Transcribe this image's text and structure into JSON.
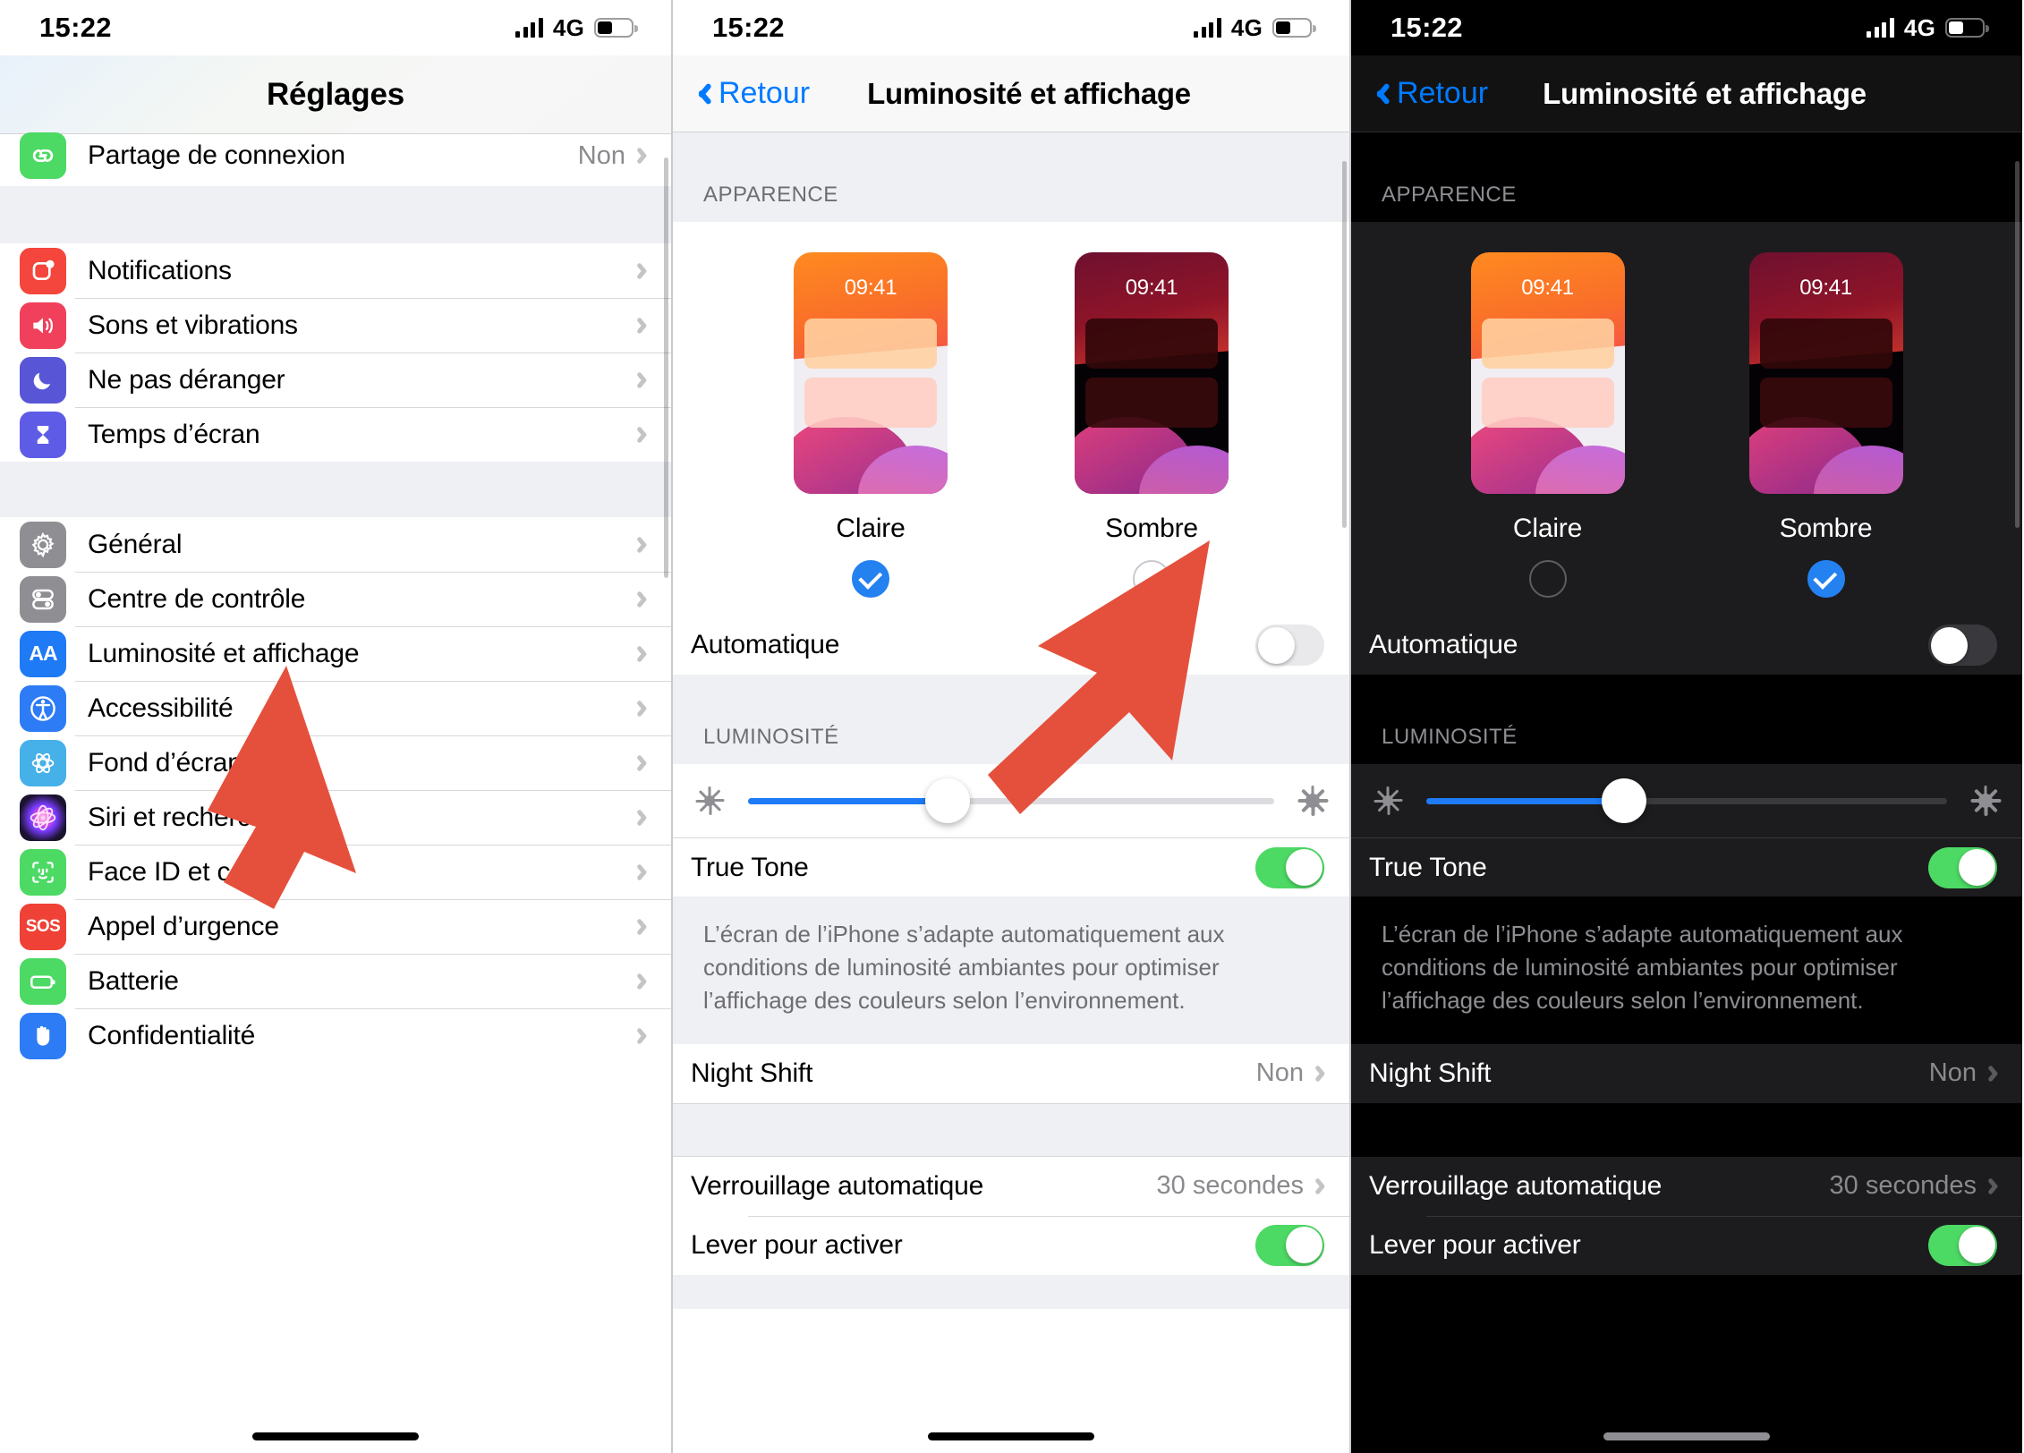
{
  "status": {
    "time": "15:22",
    "network": "4G",
    "battery_level_pct": 44
  },
  "panel1": {
    "title": "Réglages",
    "partial_row": {
      "label": "Partage de connexion",
      "value": "Non"
    },
    "group_a": [
      {
        "label": "Notifications",
        "icon": "notifications-icon",
        "color": "#f4463c"
      },
      {
        "label": "Sons et vibrations",
        "icon": "sound-icon",
        "color": "#f0405c"
      },
      {
        "label": "Ne pas déranger",
        "icon": "moon-icon",
        "color": "#5856d6"
      },
      {
        "label": "Temps d’écran",
        "icon": "hourglass-icon",
        "color": "#5e5ce6"
      }
    ],
    "group_b": [
      {
        "label": "Général",
        "icon": "gear-icon",
        "color": "#8e8e93"
      },
      {
        "label": "Centre de contrôle",
        "icon": "control-center-icon",
        "color": "#8e8e93"
      },
      {
        "label": "Luminosité et affichage",
        "icon": "brightness-aa-icon",
        "color": "#1f7af5"
      },
      {
        "label": "Accessibilité",
        "icon": "accessibility-icon",
        "color": "#2d7cf6"
      },
      {
        "label": "Fond d’écran",
        "icon": "wallpaper-icon",
        "color": "#46b0e8"
      },
      {
        "label": "Siri et recherche",
        "icon": "siri-icon",
        "color": "#1b1330"
      },
      {
        "label": "Face ID et code",
        "icon": "face-id-icon",
        "color": "#4cd964"
      },
      {
        "label": "Appel d’urgence",
        "icon": "sos-icon",
        "color": "#ef4136"
      },
      {
        "label": "Batterie",
        "icon": "battery-icon",
        "color": "#4cd964"
      },
      {
        "label": "Confidentialité",
        "icon": "privacy-hand-icon",
        "color": "#2d7cf6"
      }
    ]
  },
  "display": {
    "back_label": "Retour",
    "title": "Luminosité et affichage",
    "appearance_header": "APPARENCE",
    "modes": [
      {
        "name": "Claire",
        "clock": "09:41"
      },
      {
        "name": "Sombre",
        "clock": "09:41"
      }
    ],
    "automatic_label": "Automatique",
    "automatic_on": false,
    "brightness_header": "LUMINOSITÉ",
    "brightness_pct": 38,
    "true_tone_label": "True Tone",
    "true_tone_on": true,
    "true_tone_desc": "L’écran de l’iPhone s’adapte automatiquement aux conditions de luminosité ambiantes pour optimiser l’affichage des couleurs selon l’environnement.",
    "night_shift_label": "Night Shift",
    "night_shift_value": "Non",
    "auto_lock_label": "Verrouillage automatique",
    "auto_lock_value": "30 secondes",
    "raise_to_wake_label": "Lever pour activer",
    "raise_to_wake_on": true
  },
  "panel2_selection": "Claire",
  "panel3_selection": "Sombre",
  "colors": {
    "accent_blue": "#2481f0",
    "toggle_green": "#4cd964",
    "arrow_red": "#e5503c",
    "link_blue": "#007aff"
  }
}
